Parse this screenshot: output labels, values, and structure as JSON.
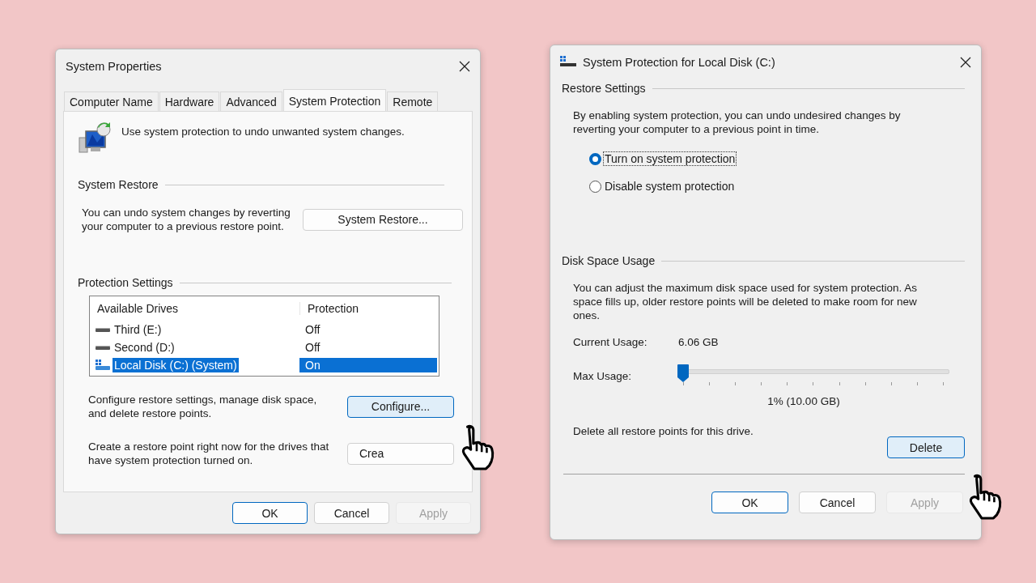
{
  "system_properties": {
    "title": "System Properties",
    "tabs": [
      {
        "label": "Computer Name",
        "selected": false
      },
      {
        "label": "Hardware",
        "selected": false
      },
      {
        "label": "Advanced",
        "selected": false
      },
      {
        "label": "System Protection",
        "selected": true
      },
      {
        "label": "Remote",
        "selected": false
      }
    ],
    "intro_text": "Use system protection to undo unwanted system changes.",
    "system_restore": {
      "heading": "System Restore",
      "text": "You can undo system changes by reverting your computer to a previous restore point.",
      "button": "System Restore..."
    },
    "protection_settings": {
      "heading": "Protection Settings",
      "columns": [
        "Available Drives",
        "Protection"
      ],
      "rows": [
        {
          "kind": "drive",
          "drive": "Third (E:)",
          "protection": "Off",
          "selected": false
        },
        {
          "kind": "drive",
          "drive": "Second (D:)",
          "protection": "Off",
          "selected": false
        },
        {
          "kind": "system",
          "drive": "Local Disk (C:) (System)",
          "protection": "On",
          "selected": true
        }
      ],
      "configure_text": "Configure restore settings, manage disk space, and delete restore points.",
      "configure_button": {
        "label": "Configure...",
        "focused": true
      },
      "create_text": "Create a restore point right now for the drives that have system protection turned on.",
      "create_button": {
        "label": "Crea",
        "focused": false
      }
    },
    "buttons": [
      {
        "label": "OK",
        "kind": "default"
      },
      {
        "label": "Cancel",
        "kind": "normal"
      },
      {
        "label": "Apply",
        "kind": "disabled"
      }
    ]
  },
  "system_protection_dialog": {
    "title": "System Protection for Local Disk (C:)",
    "restore_settings": {
      "heading": "Restore Settings",
      "text": "By enabling system protection, you can undo undesired changes by reverting your computer to a previous point in time.",
      "options": [
        {
          "label": "Turn on system protection",
          "selected": true
        },
        {
          "label": "Disable system protection",
          "selected": false
        }
      ]
    },
    "disk_space_usage": {
      "heading": "Disk Space Usage",
      "text": "You can adjust the maximum disk space used for system protection. As space fills up, older restore points will be deleted to make room for new ones.",
      "current_usage_label": "Current Usage:",
      "current_usage_value": "6.06 GB",
      "max_usage_label": "Max Usage:",
      "max_usage": {
        "level": 0.0
      },
      "reading": "1% (10.00 GB)",
      "delete_text": "Delete all restore points for this drive.",
      "delete_button": {
        "label": "Delete",
        "focused": true
      }
    },
    "buttons": [
      {
        "label": "OK",
        "kind": "default"
      },
      {
        "label": "Cancel",
        "kind": "normal"
      },
      {
        "label": "Apply",
        "kind": "disabled"
      }
    ]
  }
}
